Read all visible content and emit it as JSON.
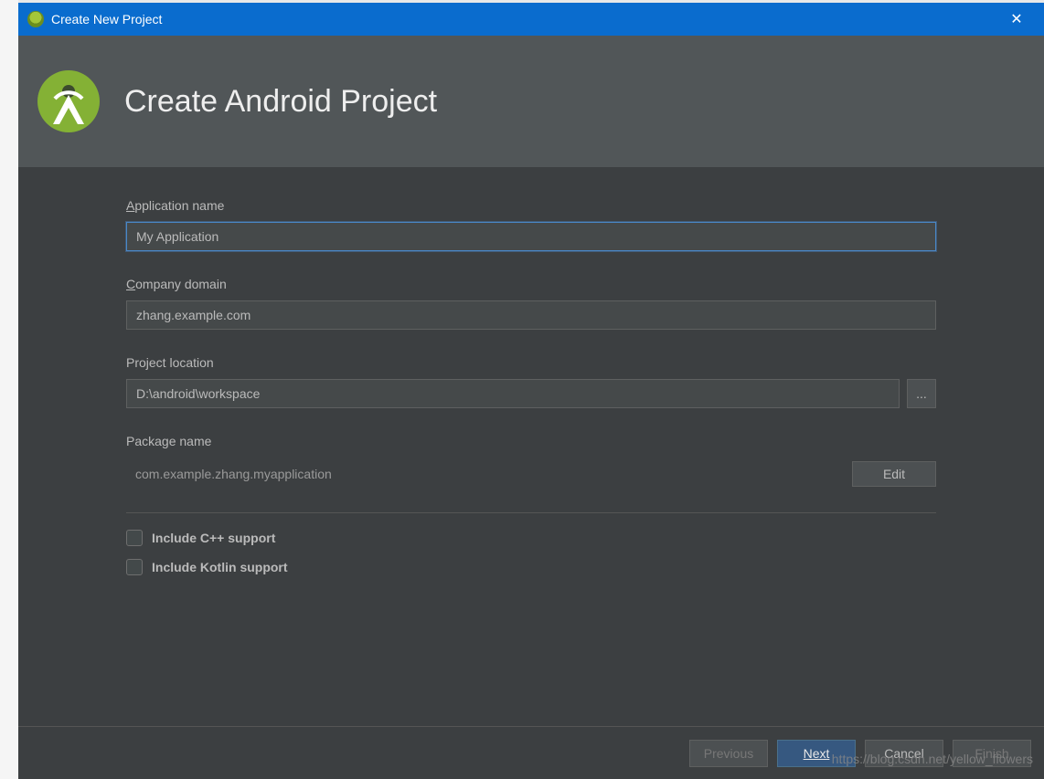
{
  "window": {
    "title": "Create New Project",
    "close_glyph": "✕"
  },
  "header": {
    "title": "Create Android Project"
  },
  "fields": {
    "app_name": {
      "label_prefix": "A",
      "label_rest": "pplication name",
      "value": "My Application"
    },
    "company_domain": {
      "label_prefix": "C",
      "label_rest": "ompany domain",
      "value": "zhang.example.com"
    },
    "project_location": {
      "label": "Project location",
      "value": "D:\\android\\workspace",
      "browse_label": "..."
    },
    "package_name": {
      "label": "Package name",
      "value": "com.example.zhang.myapplication",
      "edit_label": "Edit"
    }
  },
  "checkboxes": {
    "cpp": "Include C++ support",
    "kotlin": "Include Kotlin support"
  },
  "footer": {
    "previous": "Previous",
    "next": "Next",
    "cancel": "Cancel",
    "finish": "Finish"
  },
  "watermark": "https://blog.csdn.net/yellow_flowers"
}
